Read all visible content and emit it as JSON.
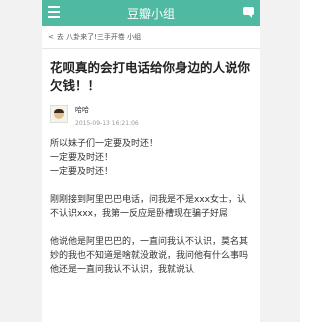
{
  "header": {
    "title": "豆瓣小组"
  },
  "breadcrumb": {
    "back": "<",
    "text": "去 八卦来了!三手开卷 小组"
  },
  "post": {
    "title": "花呗真的会打电话给你身边的人说你欠钱！！",
    "author": "哈哈",
    "time": "2015-09-13 16:21:06",
    "paragraphs": [
      "所以妹子们一定要及时还！",
      "一定要及时还！",
      "一定要及时还！",
      "",
      "刚刚接到阿里巴巴电话，问我是不是xxx女士，认不认识xxx，我第一反应是卧槽现在骗子好屌",
      "",
      "他说他是阿里巴巴的，一直问我认不认识，莫名其妙的我也不知道是啥就没敢说，我问他有什么事吗他还是一直问我认不认识，我就说认"
    ]
  },
  "colors": {
    "accent": "#4fb9a1"
  }
}
